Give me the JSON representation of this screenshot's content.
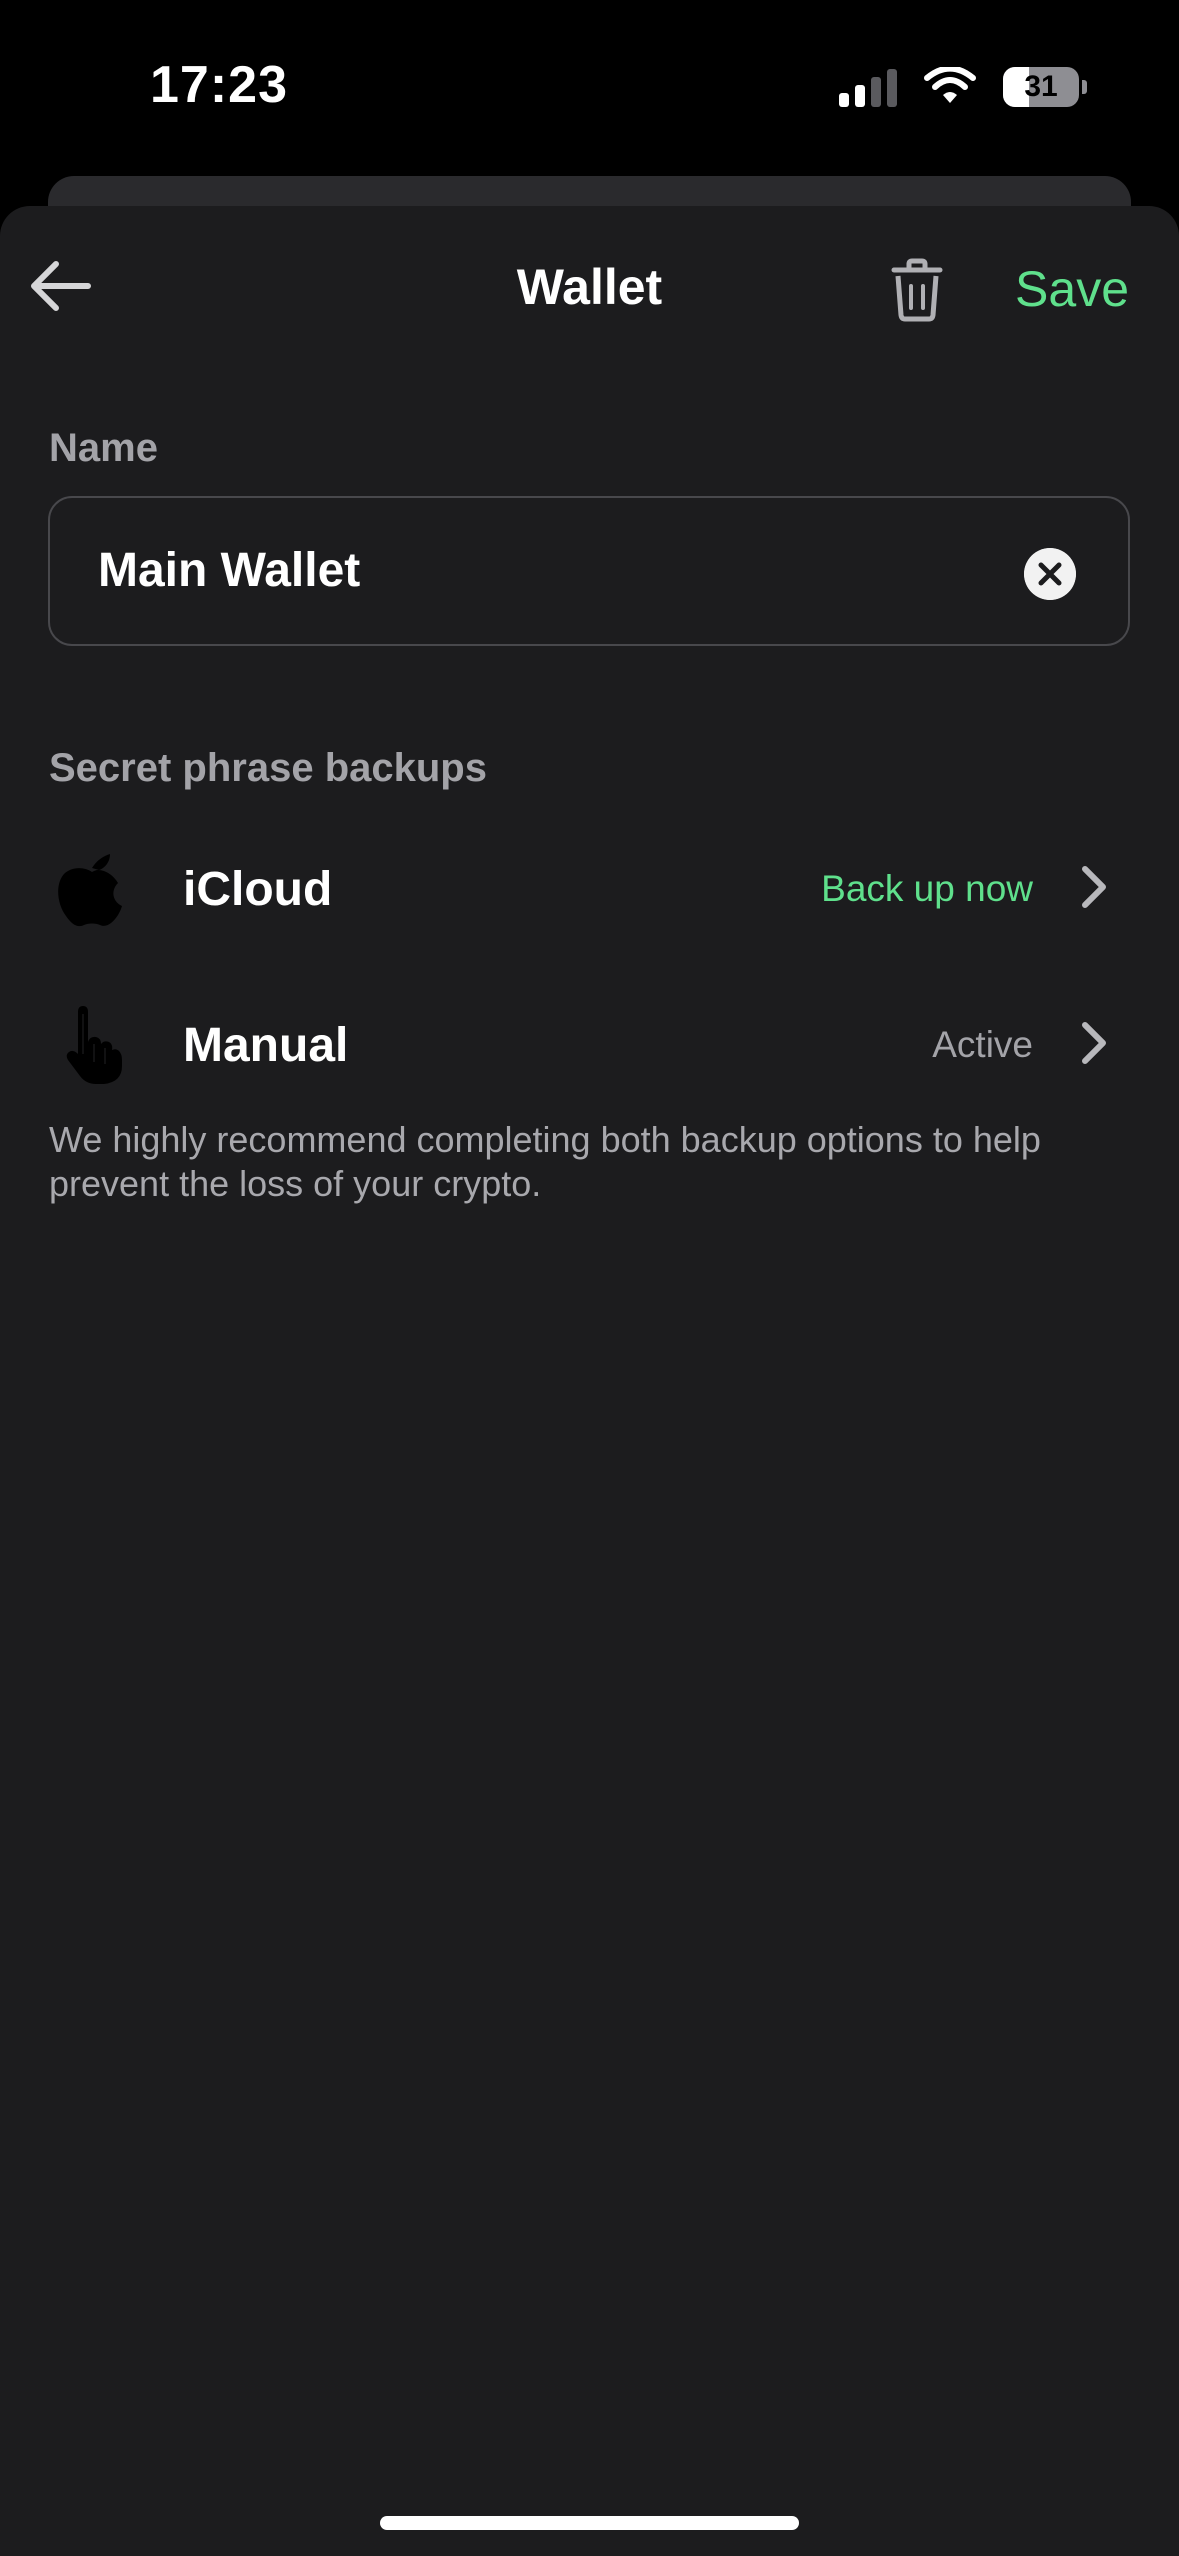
{
  "status_bar": {
    "time": "17:23",
    "battery_level": "31",
    "icons": [
      "cellular-signal-icon",
      "wifi-icon",
      "battery-icon"
    ]
  },
  "nav": {
    "title": "Wallet",
    "back_icon": "arrow-left-icon",
    "delete_icon": "trash-icon",
    "save_label": "Save"
  },
  "name_section": {
    "label": "Name",
    "value": "Main Wallet",
    "clear_icon": "clear-icon"
  },
  "backups": {
    "label": "Secret phrase backups",
    "items": [
      {
        "icon": "apple-icon",
        "label": "iCloud",
        "status": "Back up now",
        "status_color": "#5fe08c"
      },
      {
        "icon": "hand-pointer-icon",
        "label": "Manual",
        "status": "Active",
        "status_color": "#a3a3a8"
      }
    ],
    "help_text": "We highly recommend completing both backup options to help prevent the loss of your crypto."
  },
  "colors": {
    "accent": "#5fe08c",
    "background": "#1c1c1e",
    "secondary_text": "#a3a3a8"
  }
}
